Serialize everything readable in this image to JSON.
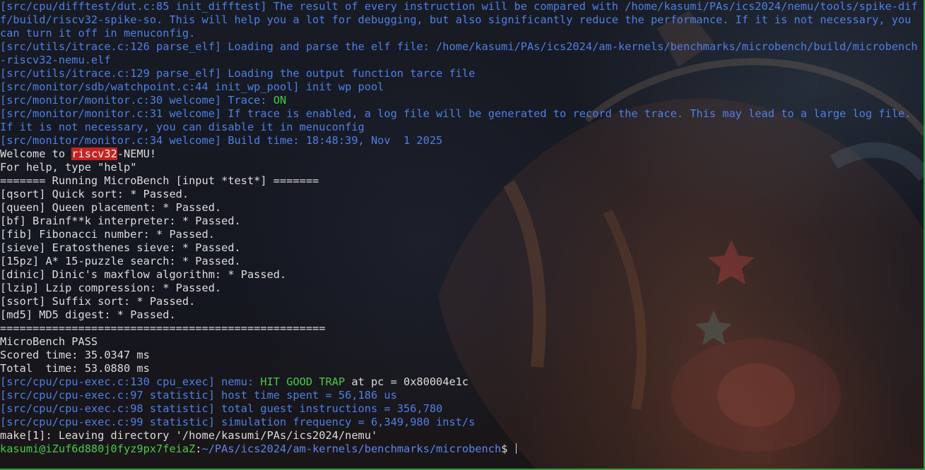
{
  "terminal": {
    "lines": [
      [
        {
          "t": "[src/cpu/difftest/dut.c:85 init_difftest] The result of every instruction will be compared with /home/kasumi/PAs/ics2024/nemu/tools/spike-diff/build/riscv32-spike-so. This will help you a lot for debugging, but also significantly reduce the performance. If it is not necessary, you can turn it off in menuconfig.",
          "c": "blue"
        }
      ],
      [
        {
          "t": "[src/utils/itrace.c:126 parse_elf] Loading and parse the elf file: /home/kasumi/PAs/ics2024/am-kernels/benchmarks/microbench/build/microbench-riscv32-nemu.elf",
          "c": "blue"
        }
      ],
      [
        {
          "t": "[src/utils/itrace.c:129 parse_elf] Loading the output function tarce file",
          "c": "blue"
        }
      ],
      [
        {
          "t": "[src/monitor/sdb/watchpoint.c:44 init_wp_pool] init wp pool",
          "c": "blue"
        }
      ],
      [
        {
          "t": "[src/monitor/monitor.c:30 welcome] Trace: ",
          "c": "blue"
        },
        {
          "t": "ON",
          "c": "green"
        }
      ],
      [
        {
          "t": "[src/monitor/monitor.c:31 welcome] If trace is enabled, a log file will be generated to record the trace. This may lead to a large log file. If it is not necessary, you can disable it in menuconfig",
          "c": "blue"
        }
      ],
      [
        {
          "t": "[src/monitor/monitor.c:34 welcome] Build time: 18:48:39, Nov  1 2025",
          "c": "blue"
        }
      ],
      [
        {
          "t": "Welcome to ",
          "c": "white"
        },
        {
          "t": "riscv32",
          "c": "red-bg"
        },
        {
          "t": "-NEMU!",
          "c": "white"
        }
      ],
      [
        {
          "t": "For help, type \"help\"",
          "c": "white"
        }
      ],
      [
        {
          "t": "======= Running MicroBench [input *test*] =======",
          "c": "white"
        }
      ],
      [
        {
          "t": "[qsort] Quick sort: * Passed.",
          "c": "white"
        }
      ],
      [
        {
          "t": "[queen] Queen placement: * Passed.",
          "c": "white"
        }
      ],
      [
        {
          "t": "[bf] Brainf**k interpreter: * Passed.",
          "c": "white"
        }
      ],
      [
        {
          "t": "[fib] Fibonacci number: * Passed.",
          "c": "white"
        }
      ],
      [
        {
          "t": "[sieve] Eratosthenes sieve: * Passed.",
          "c": "white"
        }
      ],
      [
        {
          "t": "[15pz] A* 15-puzzle search: * Passed.",
          "c": "white"
        }
      ],
      [
        {
          "t": "[dinic] Dinic's maxflow algorithm: * Passed.",
          "c": "white"
        }
      ],
      [
        {
          "t": "[lzip] Lzip compression: * Passed.",
          "c": "white"
        }
      ],
      [
        {
          "t": "[ssort] Suffix sort: * Passed.",
          "c": "white"
        }
      ],
      [
        {
          "t": "[md5] MD5 digest: * Passed.",
          "c": "white"
        }
      ],
      [
        {
          "t": "==================================================",
          "c": "white"
        }
      ],
      [
        {
          "t": "MicroBench PASS",
          "c": "white"
        }
      ],
      [
        {
          "t": "Scored time: 35.0347 ms",
          "c": "white"
        }
      ],
      [
        {
          "t": "Total  time: 53.0880 ms",
          "c": "white"
        }
      ],
      [
        {
          "t": "[src/cpu/cpu-exec.c:130 cpu_exec] nemu: ",
          "c": "blue"
        },
        {
          "t": "HIT GOOD TRAP",
          "c": "green"
        },
        {
          "t": " at pc = 0x80004e1c",
          "c": "white"
        }
      ],
      [
        {
          "t": "[src/cpu/cpu-exec.c:97 statistic] host time spent = 56,186 us",
          "c": "blue"
        }
      ],
      [
        {
          "t": "[src/cpu/cpu-exec.c:98 statistic] total guest instructions = 356,780",
          "c": "blue"
        }
      ],
      [
        {
          "t": "[src/cpu/cpu-exec.c:99 statistic] simulation frequency = 6,349,980 inst/s",
          "c": "blue"
        }
      ],
      [
        {
          "t": "make[1]: Leaving directory '/home/kasumi/PAs/ics2024/nemu'",
          "c": "white"
        }
      ]
    ],
    "prompt": {
      "user_host": "kasumi@iZuf6d880j0fyz9px7feiaZ",
      "separator": ":",
      "path": "~/PAs/ics2024/am-kernels/benchmarks/microbench",
      "symbol": "$ "
    }
  },
  "colors": {
    "blue": "#4e7fe6",
    "green": "#4ac948",
    "white": "#dcdcdc",
    "highlight": "#c4231f",
    "window_border": "#2ea043"
  }
}
